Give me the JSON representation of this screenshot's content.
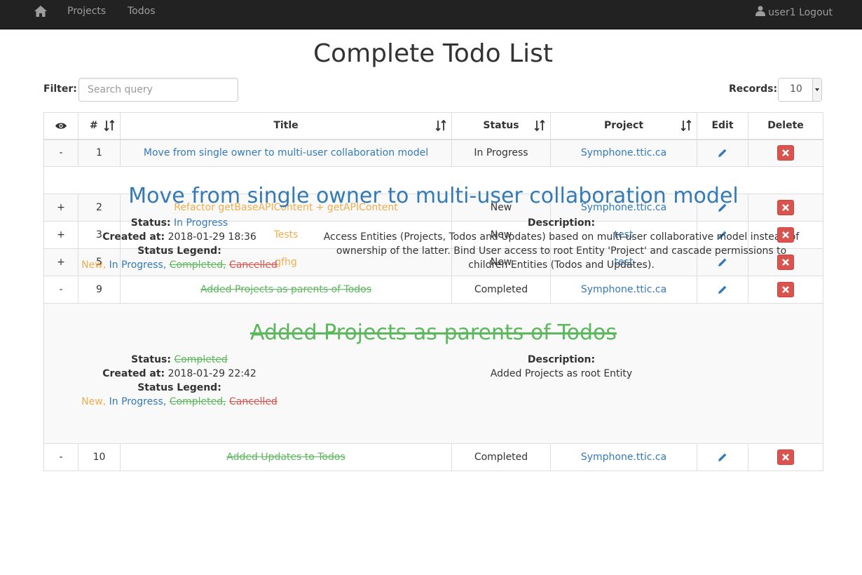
{
  "nav": {
    "home_icon": "home-icon",
    "links": [
      "Projects",
      "Todos"
    ],
    "user_label": "user1 Logout",
    "user_icon": "user-icon"
  },
  "page_title": "Complete Todo List",
  "filter": {
    "label": "Filter:",
    "placeholder": "Search query",
    "value": ""
  },
  "records": {
    "label": "Records:",
    "value": "10"
  },
  "table": {
    "headers": {
      "eye_icon": "eye-icon",
      "num": "#",
      "title": "Title",
      "status": "Status",
      "project": "Project",
      "edit": "Edit",
      "delete": "Delete"
    },
    "rows": [
      {
        "toggle": "-",
        "num": "1",
        "title": "Move from single owner to multi-user collaboration model",
        "status": "In Progress",
        "project": "Symphone.ttic.ca"
      },
      {
        "toggle": "+",
        "num": "2",
        "title": "Refactor getBaseAPIContent + getAPIContent",
        "status": "New",
        "project": "Symphone.ttic.ca"
      },
      {
        "toggle": "+",
        "num": "3",
        "title": "Tests",
        "status": "New",
        "project": "test"
      },
      {
        "toggle": "+",
        "num": "5",
        "title": "gfhg",
        "status": "New",
        "project": "test"
      },
      {
        "toggle": "-",
        "num": "9",
        "title": "Added Projects as parents of Todos",
        "status": "Completed",
        "project": "Symphone.ttic.ca"
      },
      {
        "toggle": "-",
        "num": "10",
        "title": "Added Updates to Todos",
        "status": "Completed",
        "project": "Symphone.ttic.ca"
      }
    ]
  },
  "details": [
    {
      "title": "Move from single owner to multi-user collaboration model",
      "status_label": "Status:",
      "status": "In Progress",
      "created_label": "Created at:",
      "created": "2018-01-29 18:36",
      "legend_label": "Status Legend:",
      "description_label": "Description:",
      "description": "Access Entities (Projects, Todos and Updates) based on multi-user collaborative model instead of ownership of the latter. Bind User access to root Entity 'Project' and cascade permissions to children Entities (Todos and Updates)."
    },
    {
      "title": "Added Projects as parents of Todos",
      "status_label": "Status:",
      "status": "Completed",
      "created_label": "Created at:",
      "created": "2018-01-29 22:42",
      "legend_label": "Status Legend:",
      "description_label": "Description:",
      "description": "Added Projects as root Entity"
    }
  ],
  "legend": {
    "new": "New,",
    "in_progress": "In Progress,",
    "completed": "Completed,",
    "cancelled": "Cancelled"
  },
  "colors": {
    "new": "#f0ad4e",
    "in_progress": "#337ab7",
    "completed": "#5cb85c",
    "cancelled": "#d9534f",
    "navbar": "#222222",
    "delete": "#d9534f"
  }
}
